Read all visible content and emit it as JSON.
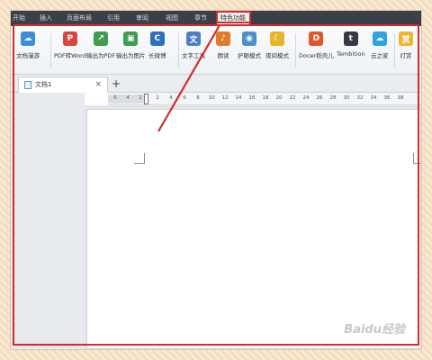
{
  "menu": {
    "items": [
      {
        "label": "开始"
      },
      {
        "label": "插入"
      },
      {
        "label": "页面布局"
      },
      {
        "label": "引用"
      },
      {
        "label": "审阅"
      },
      {
        "label": "视图"
      },
      {
        "label": "章节"
      },
      {
        "label": "特色功能"
      }
    ],
    "active_index": 7
  },
  "ribbon": {
    "tools": [
      {
        "label": "文档漫游",
        "icon": "cloud-roam-icon",
        "color": "#3a8fd9"
      },
      {
        "label": "PDF转Word",
        "icon": "pdf-to-word-icon",
        "color": "#d9453a"
      },
      {
        "label": "输出为PDF",
        "icon": "export-pdf-icon",
        "color": "#3f9e4d"
      },
      {
        "label": "输出为图片",
        "icon": "export-image-icon",
        "color": "#3f9e4d"
      },
      {
        "label": "长微博",
        "icon": "long-weibo-icon",
        "color": "#2e6fb8"
      },
      {
        "label": "文字工具",
        "icon": "text-tools-icon",
        "color": "#4a7fc2"
      },
      {
        "label": "朗读",
        "icon": "read-aloud-icon",
        "color": "#e07b2a"
      },
      {
        "label": "护眼模式",
        "icon": "eye-care-icon",
        "color": "#4a8fd1"
      },
      {
        "label": "夜间模式",
        "icon": "night-mode-icon",
        "color": "#e5b62a"
      },
      {
        "label": "Docer稻壳儿",
        "icon": "docer-icon",
        "color": "#e0552b"
      },
      {
        "label": "Tembition",
        "icon": "tembition-icon",
        "color": "#333a44"
      },
      {
        "label": "云之家",
        "icon": "yunzhijia-icon",
        "color": "#2fa2e0"
      },
      {
        "label": "打赏",
        "icon": "reward-icon",
        "color": "#f0b62e"
      }
    ]
  },
  "tabs": {
    "doc_label": "文档1",
    "close_glyph": "×",
    "add_glyph": "+"
  },
  "ruler": {
    "ticks": [
      "6",
      "4",
      "2",
      "2",
      "4",
      "6",
      "8",
      "10",
      "12",
      "14",
      "16",
      "18",
      "20",
      "22",
      "24",
      "26",
      "28",
      "30",
      "32",
      "34",
      "36",
      "38"
    ]
  },
  "watermark": "Baidu经验",
  "annotation_color": "#d42a2a"
}
